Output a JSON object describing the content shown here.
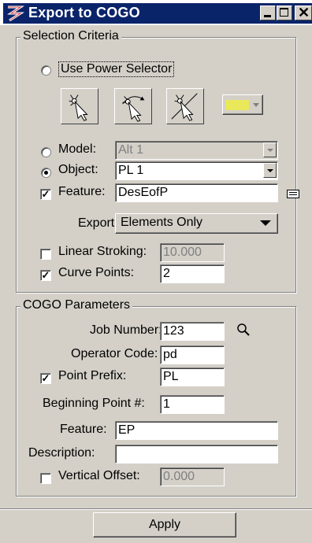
{
  "window": {
    "title": "Export to COGO",
    "controls": [
      "minimize-icon",
      "maximize-icon",
      "close-icon"
    ]
  },
  "selection": {
    "group_label": "Selection Criteria",
    "use_power_selector_label": "Use Power Selector",
    "power_selector_selected": false,
    "color_swatch": "#e8e85a",
    "model_label": "Model:",
    "model_value": "Alt 1",
    "model_selected": false,
    "object_label": "Object:",
    "object_value": "PL 1",
    "object_selected": true,
    "feature_checked": true,
    "feature_label": "Feature:",
    "feature_value": "DesEofP",
    "export_label": "Export:",
    "export_value": "Elements Only",
    "linear_stroking_checked": false,
    "linear_stroking_label": "Linear Stroking:",
    "linear_stroking_value": "10.000",
    "curve_points_checked": true,
    "curve_points_label": "Curve Points:",
    "curve_points_value": "2"
  },
  "cogo": {
    "group_label": "COGO Parameters",
    "job_number_label": "Job Number:",
    "job_number_value": "123",
    "operator_code_label": "Operator Code:",
    "operator_code_value": "pd",
    "point_prefix_checked": true,
    "point_prefix_label": "Point Prefix:",
    "point_prefix_value": "PL",
    "beginning_point_label": "Beginning Point #:",
    "beginning_point_value": "1",
    "feature_label": "Feature:",
    "feature_value": "EP",
    "description_label": "Description:",
    "description_value": "",
    "vertical_offset_checked": false,
    "vertical_offset_label": "Vertical Offset:",
    "vertical_offset_value": "0.000"
  },
  "footer": {
    "apply_label": "Apply"
  }
}
